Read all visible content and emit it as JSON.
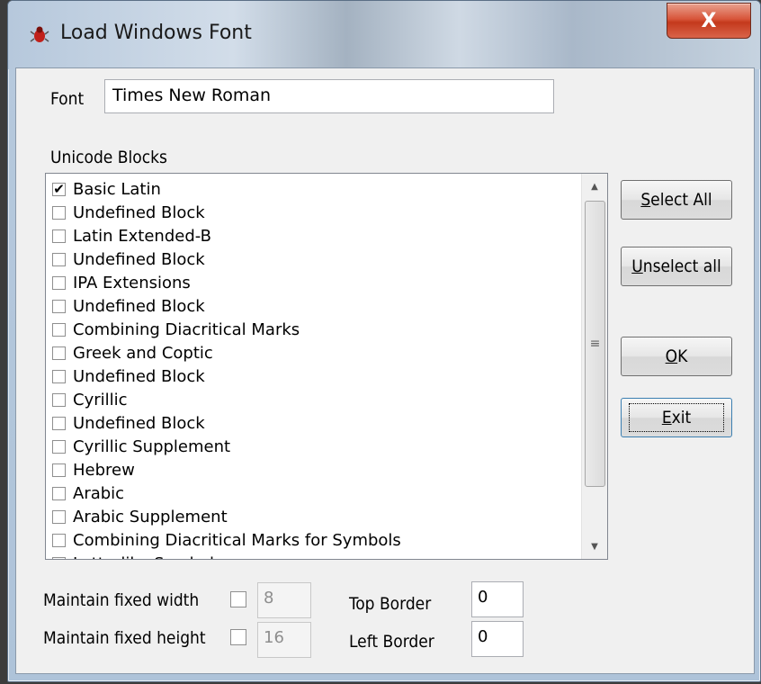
{
  "window": {
    "title": "Load Windows Font",
    "icon": "bug-icon",
    "close_glyph": "X"
  },
  "font": {
    "label": "Font",
    "value": "Times New Roman"
  },
  "blocks": {
    "label": "Unicode Blocks",
    "items": [
      {
        "label": "Basic Latin",
        "checked": true
      },
      {
        "label": "Undefined Block",
        "checked": false
      },
      {
        "label": "Latin Extended-B",
        "checked": false
      },
      {
        "label": "Undefined Block",
        "checked": false
      },
      {
        "label": "IPA Extensions",
        "checked": false
      },
      {
        "label": "Undefined Block",
        "checked": false
      },
      {
        "label": "Combining Diacritical Marks",
        "checked": false
      },
      {
        "label": "Greek and Coptic",
        "checked": false
      },
      {
        "label": "Undefined Block",
        "checked": false
      },
      {
        "label": "Cyrillic",
        "checked": false
      },
      {
        "label": "Undefined Block",
        "checked": false
      },
      {
        "label": "Cyrillic Supplement",
        "checked": false
      },
      {
        "label": "Hebrew",
        "checked": false
      },
      {
        "label": "Arabic",
        "checked": false
      },
      {
        "label": "Arabic Supplement",
        "checked": false
      },
      {
        "label": "Combining Diacritical Marks for Symbols",
        "checked": false
      },
      {
        "label": "Letterlike Symbols",
        "checked": false
      }
    ]
  },
  "buttons": {
    "select_all": {
      "accel": "S",
      "rest": "elect All"
    },
    "unselect_all": {
      "accel": "U",
      "rest": "nselect all"
    },
    "ok": {
      "accel": "O",
      "rest": "K"
    },
    "exit": {
      "accel": "E",
      "rest": "xit"
    }
  },
  "fixed_width": {
    "label": "Maintain fixed width",
    "checked": false,
    "value": "8"
  },
  "fixed_height": {
    "label": "Maintain fixed height",
    "checked": false,
    "value": "16"
  },
  "top_border": {
    "label": "Top Border",
    "value": "0"
  },
  "left_border": {
    "label": "Left Border",
    "value": "0"
  }
}
